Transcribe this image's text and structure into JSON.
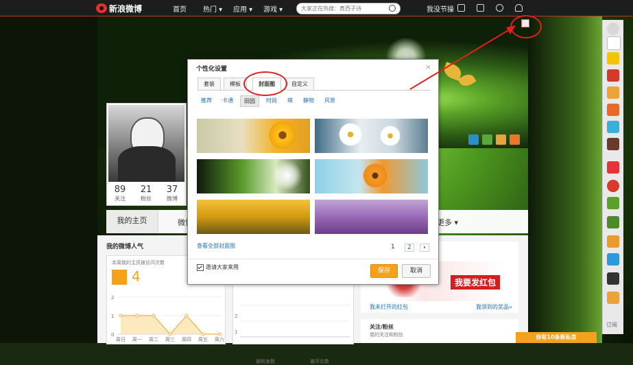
{
  "topbar": {
    "logo_text": "新浪微博",
    "nav": [
      "首页",
      "热门 ▾",
      "应用 ▾",
      "游戏 ▾"
    ],
    "search_placeholder": "大家正在热搜：真西子诗",
    "user": "我没节操"
  },
  "profile": {
    "stats": [
      {
        "value": "89",
        "label": "关注"
      },
      {
        "value": "21",
        "label": "粉丝"
      },
      {
        "value": "37",
        "label": "微博"
      }
    ]
  },
  "tabbar": {
    "home": "我的主页",
    "partial": "微博",
    "more": "更多 ▾"
  },
  "lower": {
    "popularity_title": "我的微博人气",
    "visits_label": "本周我的主页被访问次数",
    "visits_value": "4",
    "weekdays": [
      "周日",
      "周一",
      "周二",
      "周三",
      "周四",
      "周五",
      "周六"
    ],
    "y_ticks": [
      "0",
      "1",
      "2"
    ],
    "mid_x": [
      "被转发数",
      "被评论数"
    ],
    "right_mid_a": "我未打开的红包",
    "right_mid_b": "我领到的奖品»",
    "red_packet": "我要发红包",
    "follow_title": "关注/粉丝",
    "follow_sub": "我的关注和粉丝"
  },
  "modal": {
    "title": "个性化设置",
    "close": "×",
    "tabs": [
      "套装",
      "模板",
      "封面图",
      "自定义"
    ],
    "active_tab": "封面图",
    "categories": [
      "推荐",
      "卡通",
      "田园",
      "时尚",
      "萌",
      "静物",
      "风景"
    ],
    "active_category": "田园",
    "view_all": "查看全部封面图",
    "pages": [
      "1",
      "2"
    ],
    "next": "›",
    "invite": "邀请大家来用",
    "save": "保存",
    "cancel": "取消"
  },
  "sidebar": {
    "subscribe": "订阅"
  },
  "message_bar": "你有10条新私信",
  "chart_data": {
    "type": "line",
    "categories": [
      "周日",
      "周一",
      "周二",
      "周三",
      "周四",
      "周五",
      "周六"
    ],
    "values": [
      1,
      1,
      1,
      0,
      1,
      0,
      0
    ],
    "ylim": [
      0,
      2
    ]
  },
  "colors": {
    "accent": "#f6a11a",
    "annotation": "#e02020",
    "link": "#1a6fbd"
  }
}
